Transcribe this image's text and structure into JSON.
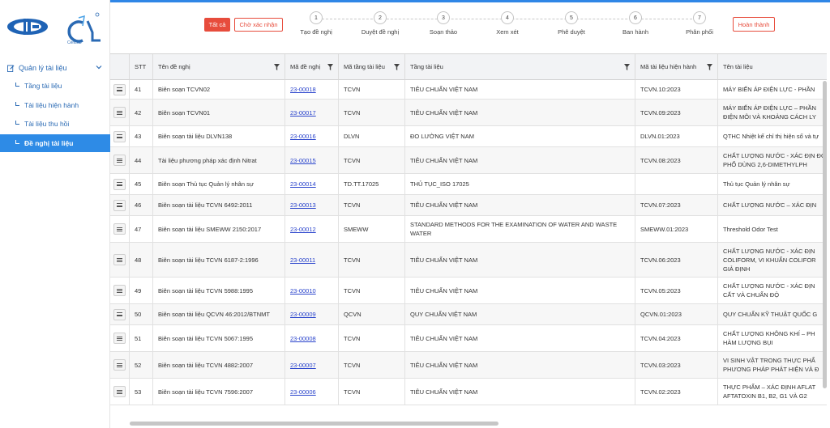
{
  "brand": {
    "logo_text": "CenLab",
    "accent": "#2e8be6",
    "danger": "#e74c3c"
  },
  "sidebar": {
    "group_label": "Quản lý tài liệu",
    "items": [
      {
        "label": "Tầng tài liệu",
        "active": false
      },
      {
        "label": "Tài liệu hiện hành",
        "active": false
      },
      {
        "label": "Tài liệu thu hồi",
        "active": false
      },
      {
        "label": "Đề nghị tài liệu",
        "active": true
      }
    ]
  },
  "filters": {
    "all_label": "Tất cả",
    "pending_label": "Chờ xác nhận",
    "done_label": "Hoàn thành",
    "steps": [
      {
        "num": "1",
        "label": "Tạo đề nghị"
      },
      {
        "num": "2",
        "label": "Duyệt đề nghị"
      },
      {
        "num": "3",
        "label": "Soạn thảo"
      },
      {
        "num": "4",
        "label": "Xem xét"
      },
      {
        "num": "5",
        "label": "Phê duyệt"
      },
      {
        "num": "6",
        "label": "Ban hành"
      },
      {
        "num": "7",
        "label": "Phân phối"
      }
    ]
  },
  "table": {
    "headers": [
      "",
      "STT",
      "Tên đề nghị",
      "Mã đề nghị",
      "Mã tầng tài liệu",
      "Tầng tài liệu",
      "Mã tài liệu hiện hành",
      "Tên tài liệu"
    ],
    "rows": [
      [
        "41",
        "Biên soạn TCVN02",
        "23-00018",
        "TCVN",
        "TIÊU CHUẨN VIỆT NAM",
        "TCVN.10:2023",
        "MÁY BIẾN ÁP ĐIỆN LỰC - PHẦN"
      ],
      [
        "42",
        "Biên soạn TCVN01",
        "23-00017",
        "TCVN",
        "TIÊU CHUẨN VIỆT NAM",
        "TCVN.09:2023",
        "MÁY BIẾN ÁP ĐIỆN LỰC – PHẦN ĐIỆN MÔI VÀ KHOẢNG CÁCH LY"
      ],
      [
        "43",
        "Biên soạn tài liệu DLVN138",
        "23-00016",
        "DLVN",
        "ĐO LƯỜNG VIỆT NAM",
        "DLVN.01:2023",
        "QTHC Nhiệt kế chỉ thị hiện số và tự"
      ],
      [
        "44",
        "Tài liệu phương pháp xác định Nitrat",
        "23-00015",
        "TCVN",
        "TIÊU CHUẨN VIỆT NAM",
        "TCVN.08:2023",
        "CHẤT LƯỢNG NƯỚC - XÁC ĐỊN ĐO PHỔ DÙNG 2,6-DIMETHYLPH"
      ],
      [
        "45",
        "Biên soạn Thủ tục Quản lý nhân sự",
        "23-00014",
        "TD.TT.17025",
        "THỦ TỤC_ISO 17025",
        "",
        "Thủ tục Quản lý nhân sự"
      ],
      [
        "46",
        "Biên soạn tài liệu TCVN 6492:2011",
        "23-00013",
        "TCVN",
        "TIÊU CHUẨN VIỆT NAM",
        "TCVN.07:2023",
        "CHẤT LƯỢNG NƯỚC – XÁC ĐỊN"
      ],
      [
        "47",
        "Biên soạn tài liệu SMEWW 2150:2017",
        "23-00012",
        "SMEWW",
        "STANDARD METHODS FOR THE EXAMINATION OF WATER AND WASTE WATER",
        "SMEWW.01:2023",
        "Threshold Odor Test"
      ],
      [
        "48",
        "Biên soạn tài liệu TCVN 6187-2:1996",
        "23-00011",
        "TCVN",
        "TIÊU CHUẨN VIỆT NAM",
        "TCVN.06:2023",
        "CHẤT LƯỢNG NƯỚC - XÁC ĐỊN COLIFORM, VI KHUẨN COLIFOR GIẢ ĐỊNH"
      ],
      [
        "49",
        "Biên soạn tài liệu TCVN 5988:1995",
        "23-00010",
        "TCVN",
        "TIÊU CHUẨN VIỆT NAM",
        "TCVN.05:2023",
        "CHẤT LƯỢNG NƯỚC - XÁC ĐỊN CẤT VÀ CHUẨN ĐỘ"
      ],
      [
        "50",
        "Biên soạn tài liệu QCVN 46:2012/BTNMT",
        "23-00009",
        "QCVN",
        "QUY CHUẨN VIỆT NAM",
        "QCVN.01:2023",
        "QUY CHUẨN KỸ THUẬT QUỐC G"
      ],
      [
        "51",
        "Biên soạn tài liệu TCVN 5067:1995",
        "23-00008",
        "TCVN",
        "TIÊU CHUẨN VIỆT NAM",
        "TCVN.04:2023",
        "CHẤT LƯỢNG KHÔNG KHÍ – PH HÀM LƯỢNG BỤI"
      ],
      [
        "52",
        "Biên soạn tài liệu TCVN 4882:2007",
        "23-00007",
        "TCVN",
        "TIÊU CHUẨN VIỆT NAM",
        "TCVN.03:2023",
        "VI SINH VẬT TRONG THỰC PHẨ PHƯƠNG PHÁP PHÁT HIỆN VÀ Đ"
      ],
      [
        "53",
        "Biên soạn tài liệu TCVN 7596:2007",
        "23-00006",
        "TCVN",
        "TIÊU CHUẨN VIỆT NAM",
        "TCVN.02:2023",
        "THỰC PHẨM – XÁC ĐỊNH AFLAT AFTATOXIN B1, B2, G1 VÀ G2"
      ]
    ]
  }
}
